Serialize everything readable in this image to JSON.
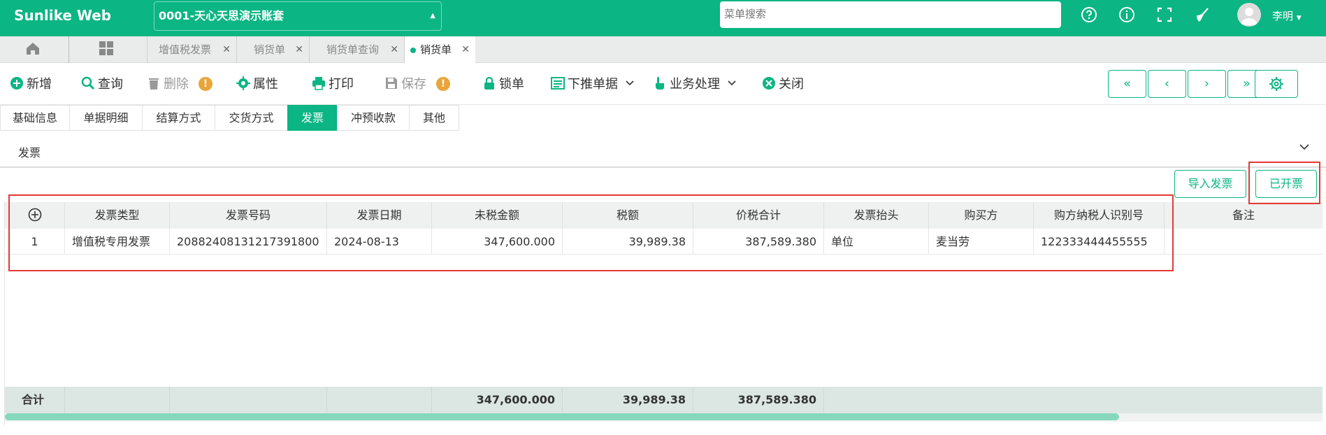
{
  "header": {
    "brand": "Sunlike Web",
    "account": "0001-天心天思演示账套",
    "search_placeholder": "菜单搜索",
    "user_name": "李明"
  },
  "tabs": {
    "items": [
      {
        "label": "增值税发票"
      },
      {
        "label": "销货单"
      },
      {
        "label": "销货单查询"
      },
      {
        "label": "销货单"
      }
    ]
  },
  "toolbar": {
    "add": "新增",
    "query": "查询",
    "delete": "删除",
    "properties": "属性",
    "print": "打印",
    "save": "保存",
    "lock": "锁单",
    "push_down": "下推单据",
    "business": "业务处理",
    "close": "关闭"
  },
  "section_tabs": [
    "基础信息",
    "单据明细",
    "结算方式",
    "交货方式",
    "发票",
    "冲预收款",
    "其他"
  ],
  "section": {
    "title": "发票",
    "import_button": "导入发票",
    "issued_button": "已开票"
  },
  "grid": {
    "add_icon": "plus-circle-icon",
    "columns": [
      "发票类型",
      "发票号码",
      "发票日期",
      "未税金额",
      "税额",
      "价税合计",
      "发票抬头",
      "购买方",
      "购方纳税人识别号",
      "备注"
    ],
    "rows": [
      [
        "1",
        "增值税专用发票",
        "20882408131217391800",
        "2024-08-13",
        "347,600.000",
        "39,989.38",
        "387,589.380",
        "单位",
        "麦当劳",
        "122333444455555",
        ""
      ]
    ],
    "footer": {
      "label": "合计",
      "untaxed": "347,600.000",
      "tax": "39,989.38",
      "total": "387,589.380"
    }
  },
  "colors": {
    "brand": "#0bb584",
    "highlight": "#e53935"
  }
}
